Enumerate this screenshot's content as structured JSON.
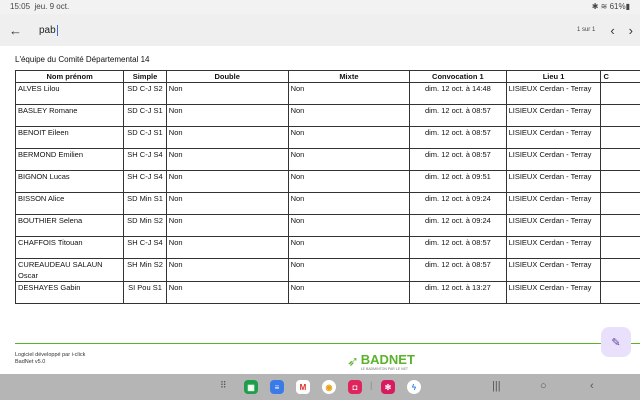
{
  "status": {
    "time": "15:05",
    "date": "jeu. 9 oct.",
    "battery": "61%"
  },
  "find": {
    "query": "pab",
    "count": "1 sur 1"
  },
  "page_title": "L'équipe du Comité Départemental 14",
  "table": {
    "headers": [
      "Nom prénom",
      "Simple",
      "Double",
      "Mixte",
      "Convocation 1",
      "Lieu 1",
      "C"
    ],
    "rows": [
      [
        "ALVES Lilou",
        "SD C-J S2",
        "Non",
        "Non",
        "dim. 12 oct. à 14:48",
        "LISIEUX Cerdan - Terray"
      ],
      [
        "BASLEY Romane",
        "SD C-J S1",
        "Non",
        "Non",
        "dim. 12 oct. à 08:57",
        "LISIEUX Cerdan - Terray"
      ],
      [
        "BENOIT Eileen",
        "SD C-J S1",
        "Non",
        "Non",
        "dim. 12 oct. à 08:57",
        "LISIEUX Cerdan - Terray"
      ],
      [
        "BERMOND Emilien",
        "SH C-J S4",
        "Non",
        "Non",
        "dim. 12 oct. à 08:57",
        "LISIEUX Cerdan - Terray"
      ],
      [
        "BIGNON Lucas",
        "SH C-J S4",
        "Non",
        "Non",
        "dim. 12 oct. à 09:51",
        "LISIEUX Cerdan - Terray"
      ],
      [
        "BISSON Alice",
        "SD Min S1",
        "Non",
        "Non",
        "dim. 12 oct. à 09:24",
        "LISIEUX Cerdan - Terray"
      ],
      [
        "BOUTHIER Selena",
        "SD Min S2",
        "Non",
        "Non",
        "dim. 12 oct. à 09:24",
        "LISIEUX Cerdan - Terray"
      ],
      [
        "CHAFFOIS Titouan",
        "SH C-J S4",
        "Non",
        "Non",
        "dim. 12 oct. à 08:57",
        "LISIEUX Cerdan - Terray"
      ],
      [
        "CUREAUDEAU SALAUN Oscar",
        "SH Min S2",
        "Non",
        "Non",
        "dim. 12 oct. à 08:57",
        "LISIEUX Cerdan - Terray"
      ],
      [
        "DESHAYES Gabin",
        "SI Pou S1",
        "Non",
        "Non",
        "dim. 12 oct. à 13:27",
        "LISIEUX Cerdan - Terray"
      ]
    ]
  },
  "footer": {
    "line1": "Logiciel développé par i-click",
    "line2": "BadNet v5.0",
    "logo": "BADNET",
    "tagline": "LE BADMINTON PAR LE NET"
  },
  "colors": {
    "accent": "#5ab32a"
  }
}
